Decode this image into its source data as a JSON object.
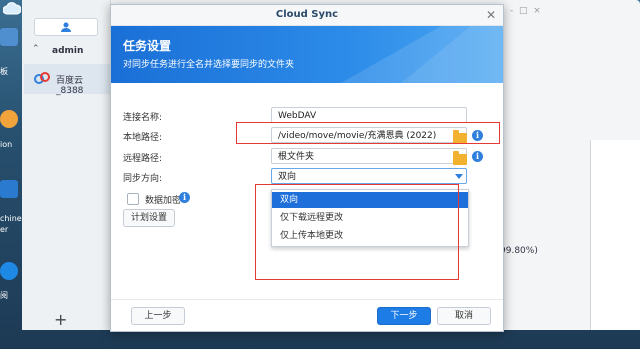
{
  "desktop": {
    "labels": [
      "板",
      "ion",
      "chine",
      "er",
      "阅"
    ]
  },
  "bg_window": {
    "user_section": "admin",
    "list_item": "百度云_8388",
    "progress_text": "99.80%)"
  },
  "dialog": {
    "window_title": "Cloud Sync",
    "banner_title": "任务设置",
    "banner_subtitle": "对同步任务进行全名并选择要同步的文件夹",
    "fields": {
      "connection_name_label": "连接名称:",
      "connection_name_value": "WebDAV",
      "local_path_label": "本地路径:",
      "local_path_value": "/video/move/movie/充满恩典 (2022)",
      "remote_path_label": "远程路径:",
      "remote_path_value": "根文件夹",
      "sync_direction_label": "同步方向:",
      "sync_direction_value": "双向"
    },
    "dropdown_options": [
      "双向",
      "仅下载远程更改",
      "仅上传本地更改"
    ],
    "encrypt_label": "数据加密",
    "schedule_button": "计划设置",
    "back_button": "上一步",
    "next_button": "下一步",
    "cancel_button": "取消"
  },
  "colors": {
    "accent": "#1e7ce6",
    "highlight_box": "#e53935"
  },
  "icons": {
    "close": "close-icon",
    "folder": "folder-icon",
    "info": "info-icon",
    "dropdown_caret": "caret-down-icon"
  }
}
